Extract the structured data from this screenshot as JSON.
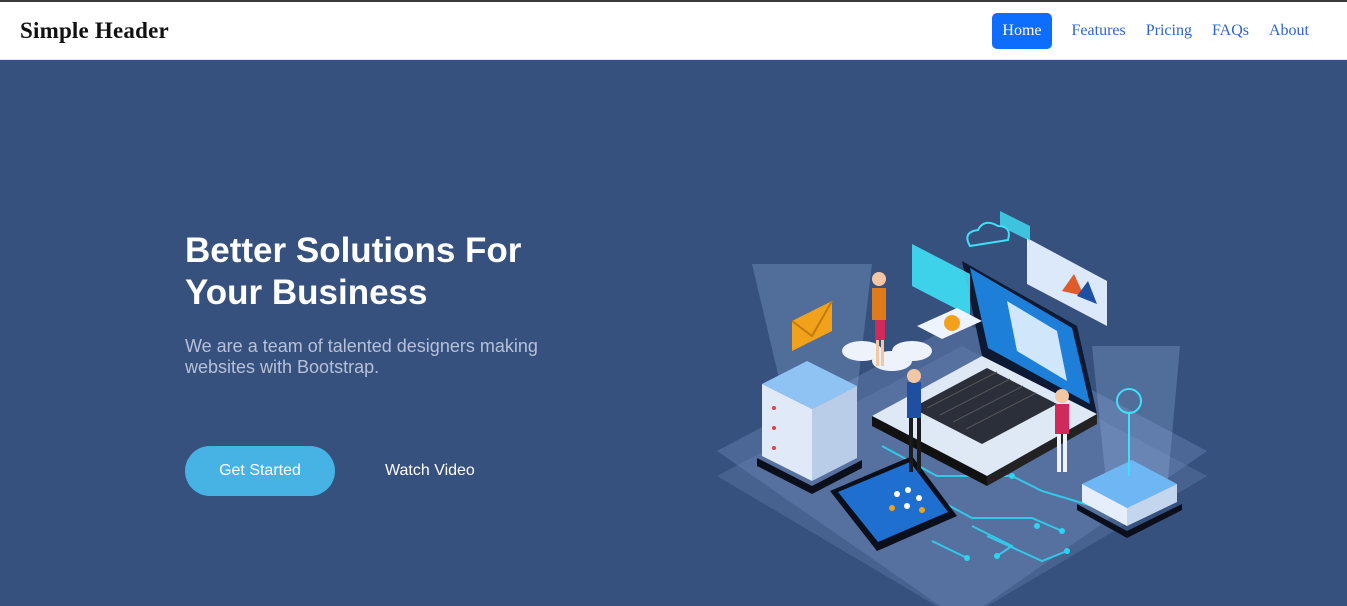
{
  "header": {
    "brand": "Simple Header",
    "nav": [
      {
        "label": "Home",
        "active": true
      },
      {
        "label": "Features",
        "active": false
      },
      {
        "label": "Pricing",
        "active": false
      },
      {
        "label": "FAQs",
        "active": false
      },
      {
        "label": "About",
        "active": false
      }
    ]
  },
  "hero": {
    "title_line1": "Better Solutions For",
    "title_line2": "Your Business",
    "subtitle": "We are a team of talented designers making websites with Bootstrap.",
    "primary_button": "Get Started",
    "secondary_link": "Watch Video",
    "illustration_icon": "isometric-tech-illustration"
  },
  "colors": {
    "hero_bg": "#37517e",
    "accent": "#47b2e4",
    "nav_active": "#0d6efd",
    "nav_link": "#2f66c8"
  }
}
